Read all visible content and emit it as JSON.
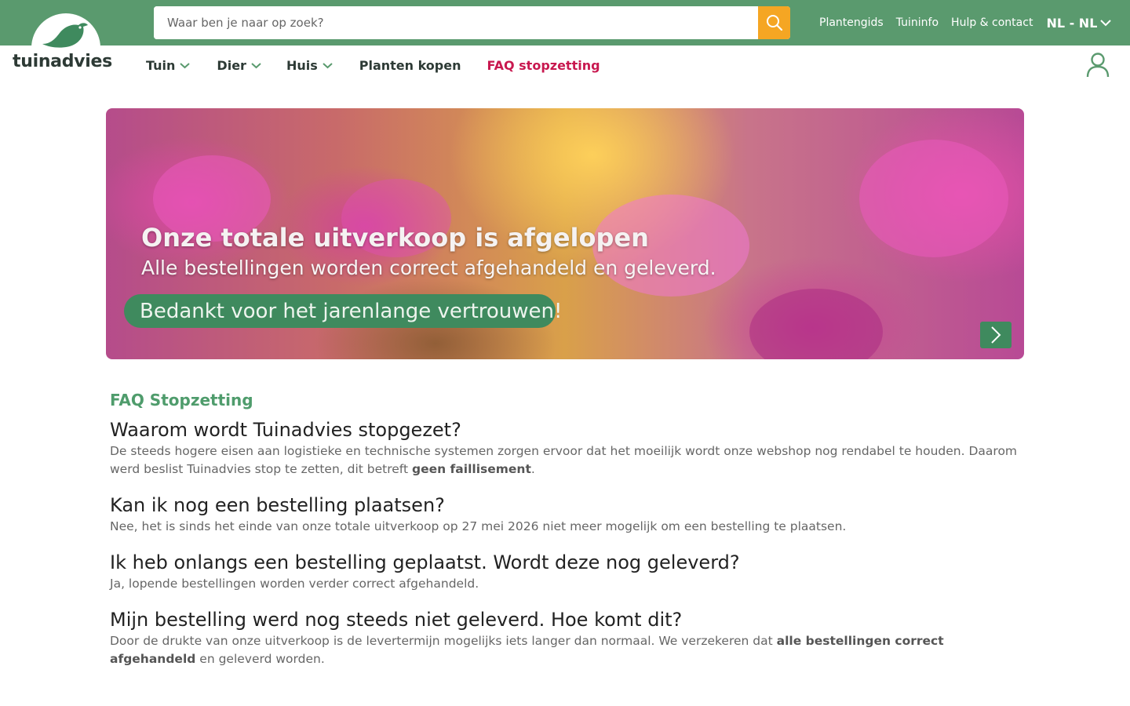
{
  "brand": {
    "name": "tuinadvies"
  },
  "search": {
    "placeholder": "Waar ben je naar op zoek?"
  },
  "toplinks": [
    "Plantengids",
    "Tuininfo",
    "Hulp & contact"
  ],
  "language": "NL - NL",
  "nav": [
    {
      "label": "Tuin",
      "dropdown": true
    },
    {
      "label": "Dier",
      "dropdown": true
    },
    {
      "label": "Huis",
      "dropdown": true
    },
    {
      "label": "Planten kopen",
      "dropdown": false
    },
    {
      "label": "FAQ stopzetting",
      "dropdown": false,
      "highlight": true
    }
  ],
  "banner": {
    "title": "Onze totale uitverkoop is afgelopen",
    "subtitle": "Alle bestellingen worden correct afgehandeld en geleverd.",
    "pill": "Bedankt voor het jarenlange vertrouwen!"
  },
  "faq": {
    "heading": "FAQ Stopzetting",
    "items": [
      {
        "question": "Waarom wordt Tuinadvies stopgezet?",
        "answer_parts": [
          {
            "text": "De steeds hogere eisen aan logistieke en technische systemen zorgen ervoor dat het moeilijk wordt onze webshop nog rendabel te houden. Daarom werd beslist Tuinadvies stop te zetten, dit betreft ",
            "bold": false
          },
          {
            "text": "geen faillisement",
            "bold": true
          },
          {
            "text": ".",
            "bold": false
          }
        ]
      },
      {
        "question": "Kan ik nog een bestelling plaatsen?",
        "answer_parts": [
          {
            "text": "Nee, het is sinds het einde van onze totale uitverkoop op 27 mei 2026 niet meer mogelijk om een bestelling te plaatsen.",
            "bold": false
          }
        ]
      },
      {
        "question": "Ik heb onlangs een bestelling geplaatst. Wordt deze nog geleverd?",
        "answer_parts": [
          {
            "text": "Ja, lopende bestellingen worden verder correct afgehandeld.",
            "bold": false
          }
        ]
      },
      {
        "question": "Mijn bestelling werd nog steeds niet geleverd. Hoe komt dit?",
        "answer_parts": [
          {
            "text": "Door de drukte van onze uitverkoop is de levertermijn mogelijks iets langer dan normaal. We verzekeren dat ",
            "bold": false
          },
          {
            "text": "alle bestellingen correct afgehandeld",
            "bold": true
          },
          {
            "text": " en geleverd worden.",
            "bold": false
          }
        ]
      }
    ]
  },
  "colors": {
    "topbar": "#5a9a6e",
    "search_button": "#f5a623",
    "faq_nav": "#c8184f",
    "faq_heading": "#4f9c6c",
    "banner_pill": "#3f8a5e"
  },
  "icons": [
    "bird-logo-icon",
    "search-icon",
    "chevron-down-icon",
    "user-icon",
    "chevron-right-icon"
  ]
}
